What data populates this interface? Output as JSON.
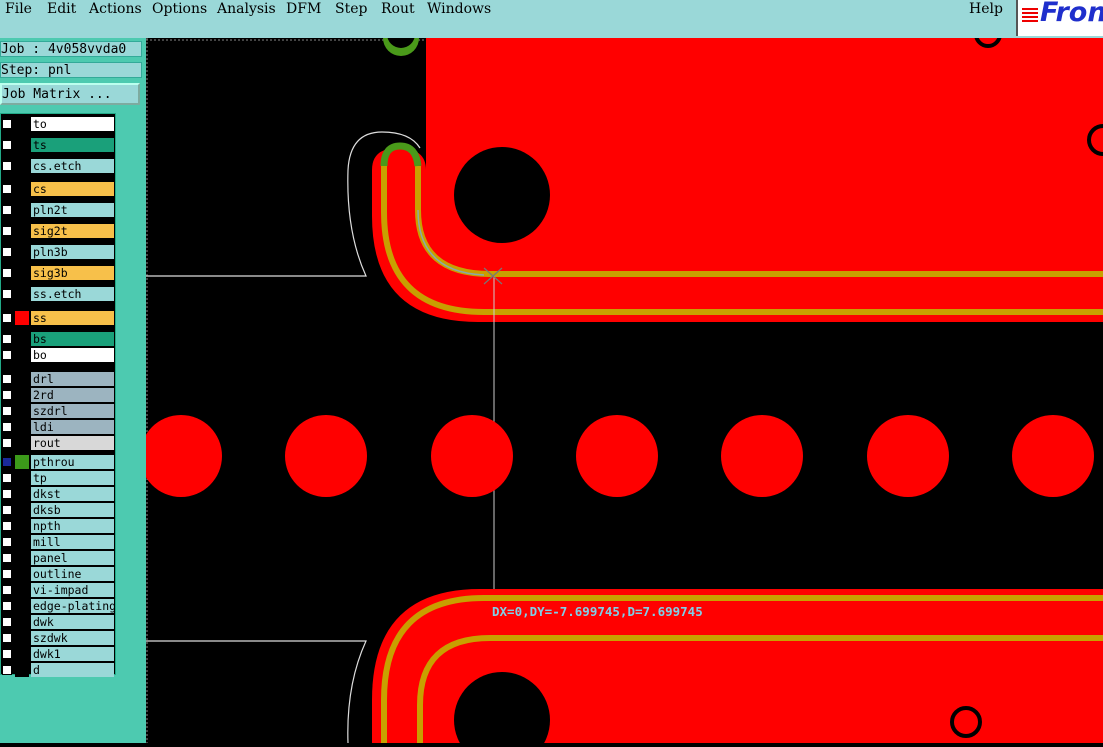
{
  "menubar": {
    "items": [
      "File",
      "Edit",
      "Actions",
      "Options",
      "Analysis",
      "DFM",
      "Step",
      "Rout",
      "Windows"
    ],
    "help": "Help",
    "logo_text": "Fron"
  },
  "job_info": {
    "job": "Job : 4v058vvda0",
    "step": "Step: pnl",
    "matrix_button": "Job Matrix ..."
  },
  "layers": [
    {
      "name": "to",
      "color": "#ffffff"
    },
    {
      "name": "ts",
      "color": "#1aa07a"
    },
    {
      "name": "cs.etch",
      "color": "#9ad8d8"
    },
    {
      "name": "cs",
      "color": "#f7c04a"
    },
    {
      "name": "pln2t",
      "color": "#9ad8d8"
    },
    {
      "name": "sig2t",
      "color": "#f7c04a"
    },
    {
      "name": "pln3b",
      "color": "#9ad8d8"
    },
    {
      "name": "sig3b",
      "color": "#f7c04a"
    },
    {
      "name": "ss.etch",
      "color": "#9ad8d8"
    },
    {
      "name": "ss",
      "color": "#f7c04a",
      "swatch": "#ff0000"
    },
    {
      "name": "bs",
      "color": "#1aa07a"
    },
    {
      "name": "bo",
      "color": "#ffffff"
    },
    {
      "name": "drl",
      "color": "#9cb4c0"
    },
    {
      "name": "2rd",
      "color": "#9cb4c0"
    },
    {
      "name": "szdrl",
      "color": "#9cb4c0"
    },
    {
      "name": "ldi",
      "color": "#9cb4c0"
    },
    {
      "name": "rout",
      "color": "#d8d8d8"
    },
    {
      "name": "pthrou",
      "color": "#9ad8d8",
      "swatch": "#3c9a1a"
    },
    {
      "name": "tp",
      "color": "#9ad8d8"
    },
    {
      "name": "dkst",
      "color": "#9ad8d8"
    },
    {
      "name": "dksb",
      "color": "#9ad8d8"
    },
    {
      "name": "npth",
      "color": "#9ad8d8"
    },
    {
      "name": "mill",
      "color": "#9ad8d8"
    },
    {
      "name": "panel",
      "color": "#9ad8d8"
    },
    {
      "name": "outline",
      "color": "#9ad8d8"
    },
    {
      "name": "vi-impad",
      "color": "#9ad8d8"
    },
    {
      "name": "edge-plating",
      "color": "#9ad8d8"
    },
    {
      "name": "dwk",
      "color": "#9ad8d8"
    },
    {
      "name": "szdwk",
      "color": "#9ad8d8"
    },
    {
      "name": "dwk1",
      "color": "#9ad8d8"
    },
    {
      "name": "d",
      "color": "#9ad8d8"
    }
  ],
  "measure_readout": "DX=0,DY=-7.699745,D=7.699745",
  "colors": {
    "copper": "#ff0000",
    "plating_edge": "#c8a000",
    "background": "#000000",
    "menubar": "#9ad8d8",
    "panel": "#4dcab0"
  }
}
